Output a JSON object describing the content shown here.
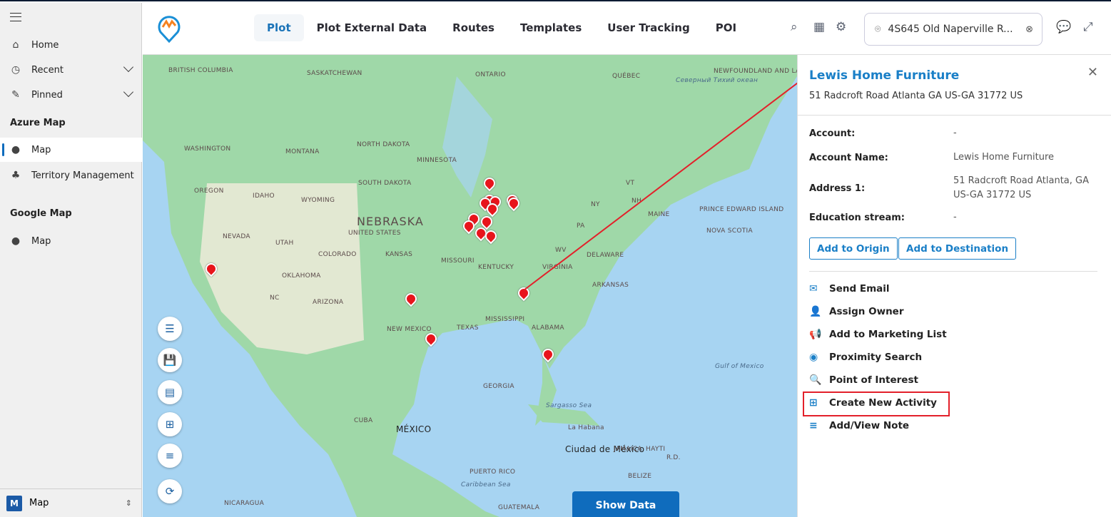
{
  "sidebar": {
    "items": [
      {
        "label": "Home",
        "icon": "home-icon"
      },
      {
        "label": "Recent",
        "icon": "clock-icon"
      },
      {
        "label": "Pinned",
        "icon": "pin-icon"
      }
    ],
    "sections": [
      {
        "title": "Azure Map",
        "items": [
          {
            "label": "Map"
          },
          {
            "label": "Territory Management"
          }
        ]
      },
      {
        "title": "Google Map",
        "items": [
          {
            "label": "Map"
          }
        ]
      }
    ],
    "footer": {
      "badge": "M",
      "label": "Map"
    }
  },
  "header": {
    "tabs": [
      "Plot",
      "Plot External Data",
      "Routes",
      "Templates",
      "User Tracking",
      "POI"
    ],
    "active_tab": "Plot",
    "search_value": "4S645 Old Naperville R..."
  },
  "map": {
    "labels": [
      "BRITISH COLUMBIA",
      "SASKATCHEWAN",
      "ONTARIO",
      "QUÉBEC",
      "NEWFOUNDLAND AND LABRADOR",
      "WASHINGTON",
      "MONTANA",
      "NORTH DAKOTA",
      "MINNESOTA",
      "MAINE",
      "PRINCE EDWARD ISLAND",
      "NOVA SCOTIA",
      "OREGON",
      "IDAHO",
      "WYOMING",
      "SOUTH DAKOTA",
      "VT",
      "NH",
      "NY",
      "NEBRASKA",
      "UNITED STATES",
      "PA",
      "NEVADA",
      "UTAH",
      "COLORADO",
      "KANSAS",
      "MISSOURI",
      "DELAWARE",
      "WV",
      "KENTUCKY",
      "VIRGINIA",
      "OKLAHOMA",
      "ARKANSAS",
      "NC",
      "ARIZONA",
      "NEW MEXICO",
      "TEXAS",
      "MISSISSIPPI",
      "ALABAMA",
      "GEORGIA",
      "Gulf of Mexico",
      "Sargasso Sea",
      "La Habana",
      "CUBA",
      "MÉXICO",
      "Ciudad de México",
      "JAMAICA",
      "HAYTI",
      "R.D.",
      "PUERTO RICO",
      "BELIZE",
      "Caribbean Sea",
      "GUATEMALA",
      "NICARAGUA",
      "Северный Тихий океан",
      "POI"
    ],
    "show_data_label": "Show Data"
  },
  "panel": {
    "title": "Lewis Home Furniture",
    "address": "51 Radcroft Road Atlanta GA US-GA 31772 US",
    "fields": [
      {
        "label": "Account:",
        "value": "-"
      },
      {
        "label": "Account Name:",
        "value": "Lewis Home Furniture"
      },
      {
        "label": "Address 1:",
        "value": "51 Radcroft Road Atlanta, GA US-GA 31772 US"
      },
      {
        "label": "Education stream:",
        "value": "-"
      }
    ],
    "buttons": [
      "Add to Origin",
      "Add to Destination"
    ],
    "actions": [
      {
        "label": "Send Email",
        "icon": "email-icon"
      },
      {
        "label": "Assign Owner",
        "icon": "user-edit-icon"
      },
      {
        "label": "Add to Marketing List",
        "icon": "megaphone-icon"
      },
      {
        "label": "Proximity Search",
        "icon": "target-icon"
      },
      {
        "label": "Point of Interest",
        "icon": "poi-search-icon"
      },
      {
        "label": "Create New Activity",
        "icon": "plus-square-icon"
      },
      {
        "label": "Add/View Note",
        "icon": "note-icon"
      }
    ]
  },
  "colors": {
    "accent": "#1a7fc7",
    "pin": "#e8141c",
    "highlight": "#e3202a"
  }
}
